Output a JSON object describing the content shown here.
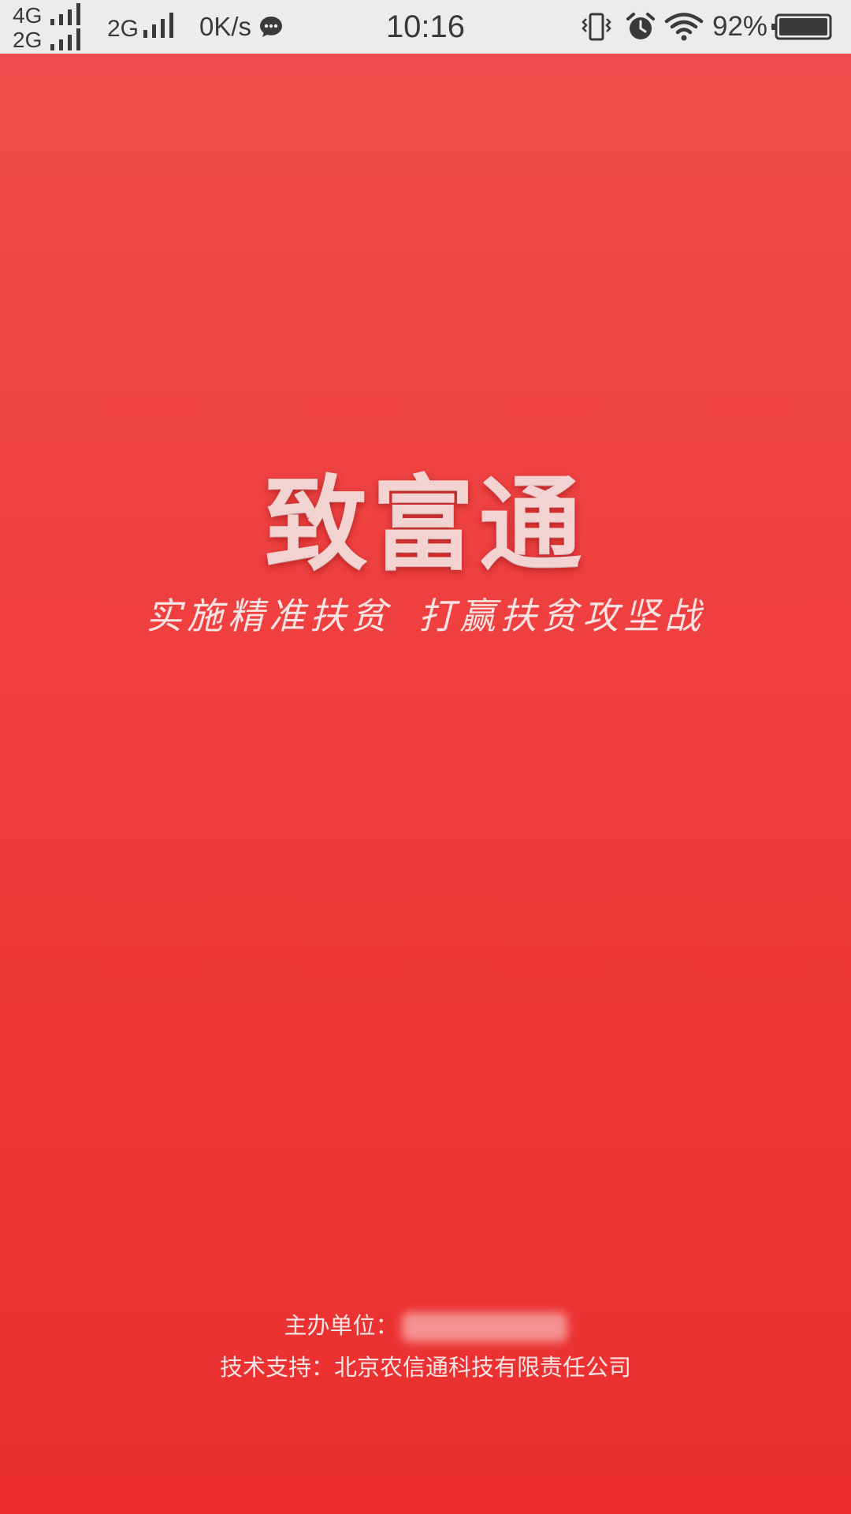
{
  "status_bar": {
    "network_primary": "4G",
    "network_secondary": "2G",
    "network_sim2": "2G",
    "speed": "0K/s",
    "time": "10:16",
    "battery_percent": "92%",
    "battery_level": 0.92,
    "icons": [
      "signal-icon",
      "chat-icon",
      "vibrate-icon",
      "alarm-icon",
      "wifi-icon",
      "battery-icon"
    ]
  },
  "splash": {
    "app_name": "致富通",
    "slogan_part1": "实施精准扶贫",
    "slogan_part2": "打赢扶贫攻坚战",
    "organizer_label": "主办单位：",
    "support_label": "技术支持：",
    "support_company": "北京农信通科技有限责任公司",
    "background_color": "#ee3a3a",
    "text_color": "#fbe6e6"
  }
}
